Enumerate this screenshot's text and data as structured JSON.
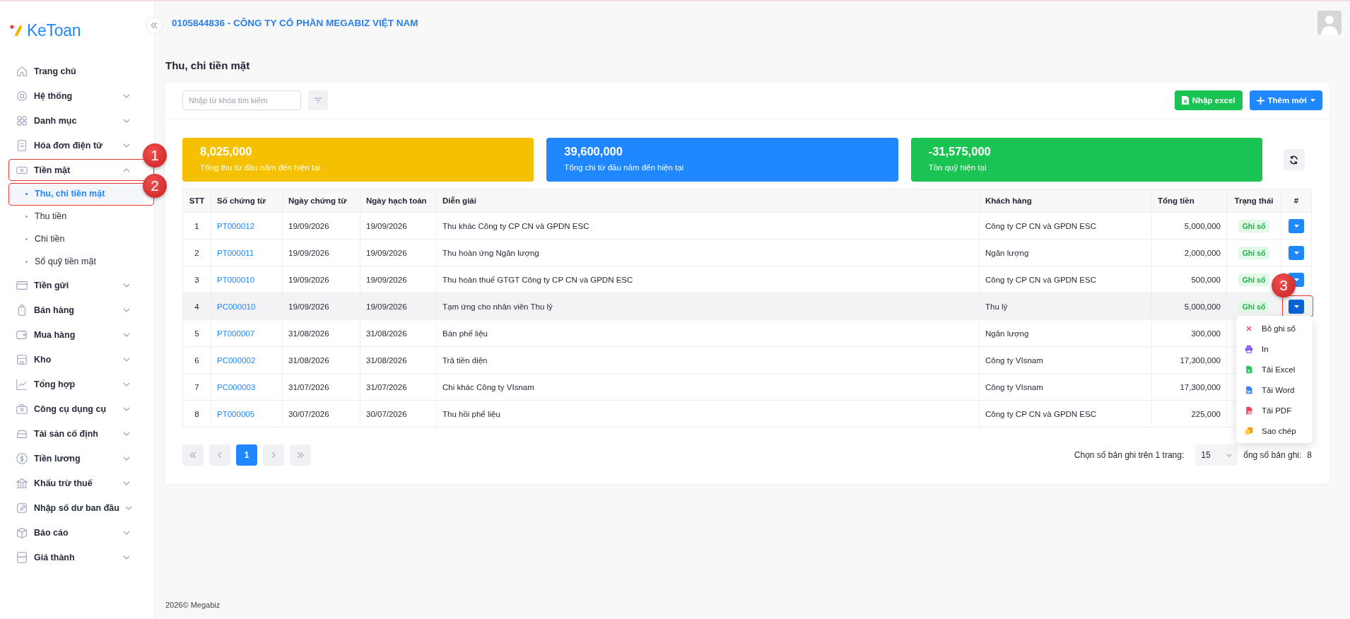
{
  "logo": {
    "text": "KeToan"
  },
  "sidebar": {
    "items": [
      {
        "label": "Trang chủ",
        "kind": "link"
      },
      {
        "label": "Hệ thống",
        "kind": "group",
        "expanded": false
      },
      {
        "label": "Danh mục",
        "kind": "group",
        "expanded": false
      },
      {
        "label": "Hóa đơn điện tử",
        "kind": "group",
        "expanded": false
      },
      {
        "label": "Tiền mặt",
        "kind": "group",
        "expanded": true,
        "annotation": "1",
        "children": [
          {
            "label": "Thu, chi tiền mặt",
            "selected": true,
            "annotation": "2"
          },
          {
            "label": "Thu tiền",
            "selected": false
          },
          {
            "label": "Chi tiền",
            "selected": false
          },
          {
            "label": "Sổ quỹ tiền mặt",
            "selected": false
          }
        ]
      },
      {
        "label": "Tiền gửi",
        "kind": "group",
        "expanded": false
      },
      {
        "label": "Bán hàng",
        "kind": "group",
        "expanded": false
      },
      {
        "label": "Mua hàng",
        "kind": "group",
        "expanded": false
      },
      {
        "label": "Kho",
        "kind": "group",
        "expanded": false
      },
      {
        "label": "Tổng hợp",
        "kind": "group",
        "expanded": false
      },
      {
        "label": "Công cụ dụng cụ",
        "kind": "group",
        "expanded": false
      },
      {
        "label": "Tài sản cố định",
        "kind": "group",
        "expanded": false
      },
      {
        "label": "Tiền lương",
        "kind": "group",
        "expanded": false
      },
      {
        "label": "Khấu trừ thuế",
        "kind": "group",
        "expanded": false
      },
      {
        "label": "Nhập số dư ban đầu",
        "kind": "group",
        "expanded": false
      },
      {
        "label": "Báo cáo",
        "kind": "group",
        "expanded": false
      },
      {
        "label": "Giá thành",
        "kind": "group",
        "expanded": false
      }
    ]
  },
  "header": {
    "company": "0105844836 - CÔNG TY CỔ PHẦN MEGABIZ VIỆT NAM"
  },
  "page_title": "Thu, chi tiền mặt",
  "search": {
    "placeholder": "Nhập từ khóa tìm kiếm"
  },
  "buttons": [
    {
      "label": "Nhập excel",
      "kind": "excel"
    },
    {
      "label": "Thêm mới",
      "kind": "add"
    }
  ],
  "stats": [
    {
      "value": "8,025,000",
      "label": "Tổng thu từ đầu năm đến hiện tại",
      "color": "#f5c000"
    },
    {
      "value": "39,600,000",
      "label": "Tổng chi từ đầu năm đến hiện tại",
      "color": "#1f87ff"
    },
    {
      "value": "-31,575,000",
      "label": "Tồn quỹ hiện tại",
      "color": "#19c452"
    }
  ],
  "table": {
    "columns": [
      "STT",
      "Số chứng từ",
      "Ngày chứng từ",
      "Ngày hạch toán",
      "Diễn giải",
      "Khách hàng",
      "Tổng tiền",
      "Trạng thái",
      "#"
    ],
    "rows": [
      {
        "stt": "1",
        "doc": "PT000012",
        "date": "19/09/2026",
        "posting_date": "19/09/2026",
        "description": "Thu khác Công ty CP CN và GPDN ESC",
        "customer": "Công ty CP CN và GPDN ESC",
        "amount": "5,000,000",
        "status": "Ghi sổ",
        "selected": false,
        "menu_open": false
      },
      {
        "stt": "2",
        "doc": "PT000011",
        "date": "19/09/2026",
        "posting_date": "19/09/2026",
        "description": "Thu hoàn ứng Ngân lượng",
        "customer": "Ngân lượng",
        "amount": "2,000,000",
        "status": "Ghi sổ",
        "selected": false,
        "menu_open": false
      },
      {
        "stt": "3",
        "doc": "PT000010",
        "date": "19/09/2026",
        "posting_date": "19/09/2026",
        "description": "Thu hoàn thuế GTGT Công ty CP CN và GPDN ESC",
        "customer": "Công ty CP CN và GPDN ESC",
        "amount": "500,000",
        "status": "Ghi sổ",
        "selected": false,
        "menu_open": false
      },
      {
        "stt": "4",
        "doc": "PC000010",
        "date": "19/09/2026",
        "posting_date": "19/09/2026",
        "description": "Tạm ứng cho nhân viên Thu lý",
        "customer": "Thu lý",
        "amount": "5,000,000",
        "status": "Ghi sổ",
        "selected": true,
        "menu_open": true,
        "annotation": "3"
      },
      {
        "stt": "5",
        "doc": "PT000007",
        "date": "31/08/2026",
        "posting_date": "31/08/2026",
        "description": "Bán phế liệu",
        "customer": "Ngân lượng",
        "amount": "300,000",
        "selected": false
      },
      {
        "stt": "6",
        "doc": "PC000002",
        "date": "31/08/2026",
        "posting_date": "31/08/2026",
        "description": "Trả tiền điện",
        "customer": "Công ty VIsnam",
        "amount": "17,300,000",
        "selected": false
      },
      {
        "stt": "7",
        "doc": "PC000003",
        "date": "31/07/2026",
        "posting_date": "31/07/2026",
        "description": "Chi khác Công ty VIsnam",
        "customer": "Công ty VIsnam",
        "amount": "17,300,000",
        "selected": false
      },
      {
        "stt": "8",
        "doc": "PT000005",
        "date": "30/07/2026",
        "posting_date": "30/07/2026",
        "description": "Thu hồi phế liệu",
        "customer": "Công ty CP CN và GPDN ESC",
        "amount": "225,000",
        "selected": false
      }
    ]
  },
  "action_menu": [
    {
      "label": "Bỏ ghi sổ",
      "kind": "unpost"
    },
    {
      "label": "In",
      "kind": "print"
    },
    {
      "label": "Tải Excel",
      "kind": "excel"
    },
    {
      "label": "Tải Word",
      "kind": "word"
    },
    {
      "label": "Tải PDF",
      "kind": "pdf"
    },
    {
      "label": "Sao chép",
      "kind": "copy"
    }
  ],
  "pager": {
    "pages": [
      {
        "label": "1",
        "selected": true
      }
    ],
    "page_size_label": "Chọn số bản ghi trên 1 trang:",
    "page_size": "15",
    "total_label": "ổng số bản ghi:",
    "total": "8"
  },
  "footer": "2026© Megabiz"
}
